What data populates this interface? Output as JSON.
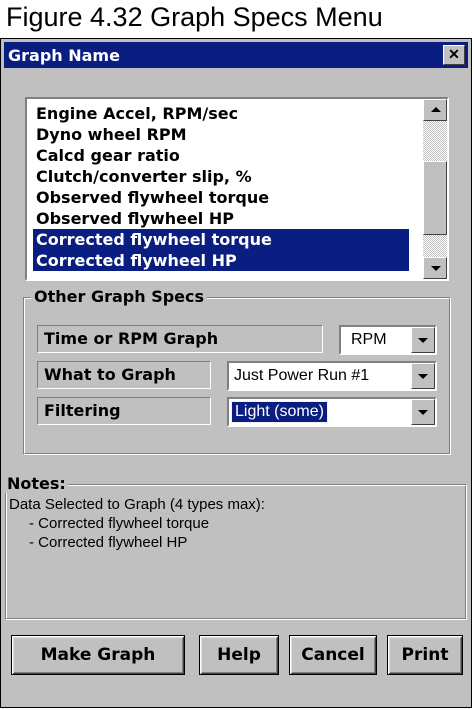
{
  "caption": "Figure 4.32  Graph Specs Menu",
  "window": {
    "title": "Graph Name",
    "close_label": "✕"
  },
  "graph_list": {
    "items": [
      {
        "label": "Engine Accel, RPM/sec",
        "selected": false
      },
      {
        "label": "Dyno wheel RPM",
        "selected": false
      },
      {
        "label": "Calcd gear ratio",
        "selected": false
      },
      {
        "label": "Clutch/converter slip, %",
        "selected": false
      },
      {
        "label": "Observed flywheel torque",
        "selected": false
      },
      {
        "label": "Observed flywheel HP",
        "selected": false
      },
      {
        "label": "Corrected flywheel torque",
        "selected": true
      },
      {
        "label": "Corrected flywheel HP",
        "selected": true
      }
    ]
  },
  "other_specs": {
    "legend": "Other Graph Specs",
    "time_or_rpm": {
      "label": "Time or RPM Graph",
      "value": "RPM"
    },
    "what_to_graph": {
      "label": "What to Graph",
      "value": "Just Power Run #1"
    },
    "filtering": {
      "label": "Filtering",
      "value": "Light (some)"
    }
  },
  "notes": {
    "title": "Notes:",
    "header": "Data Selected to Graph (4 types max):",
    "lines": [
      "- Corrected flywheel torque",
      "- Corrected flywheel HP"
    ]
  },
  "buttons": {
    "make_graph": "Make Graph",
    "help": "Help",
    "cancel": "Cancel",
    "print": "Print"
  },
  "colors": {
    "titlebar": "#0a1e82",
    "selection": "#0a1e82",
    "face": "#c0c0c0"
  }
}
